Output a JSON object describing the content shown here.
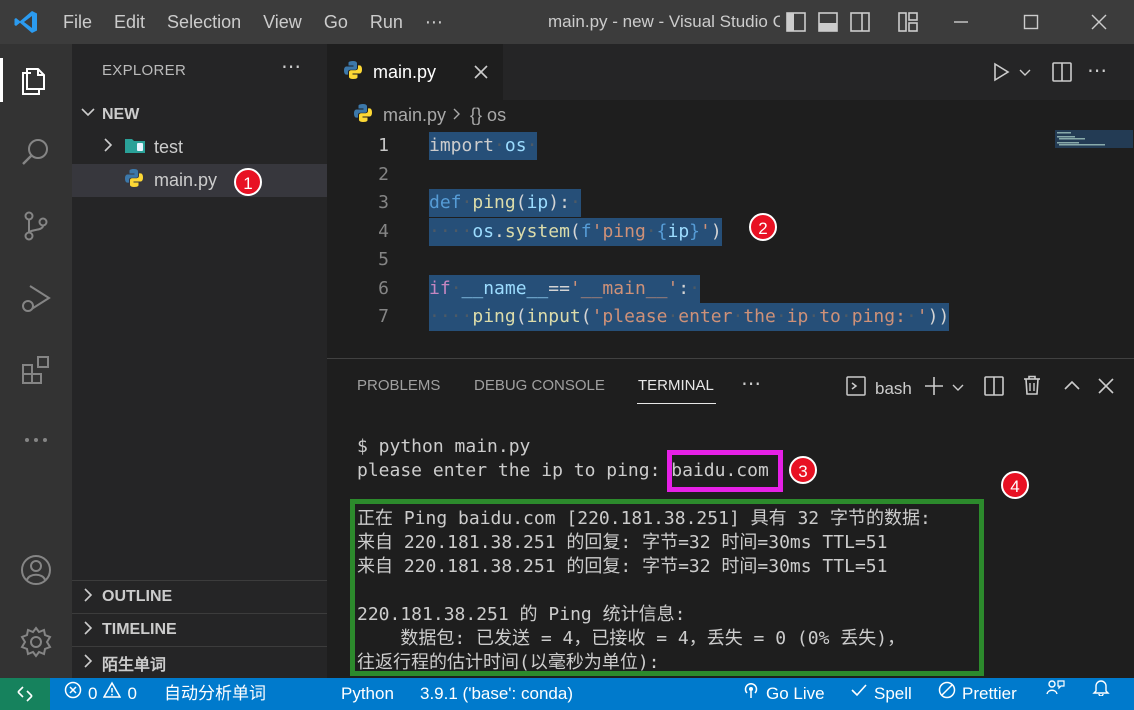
{
  "titlebar": {
    "menu": [
      "File",
      "Edit",
      "Selection",
      "View",
      "Go",
      "Run",
      "⋯"
    ],
    "window_title": "main.py - new - Visual Studio Code"
  },
  "sidebar": {
    "title": "EXPLORER",
    "more": "⋯",
    "folder": "NEW",
    "items": [
      {
        "label": "test",
        "type": "folder"
      },
      {
        "label": "main.py",
        "type": "python-file"
      }
    ],
    "sections": [
      "OUTLINE",
      "TIMELINE",
      "陌生单词"
    ]
  },
  "editor": {
    "tab_label": "main.py",
    "breadcrumb": {
      "file": "main.py",
      "symbol": "{} os"
    },
    "line_numbers": [
      "1",
      "2",
      "3",
      "4",
      "5",
      "6",
      "7"
    ]
  },
  "panel": {
    "tabs": [
      "PROBLEMS",
      "DEBUG CONSOLE",
      "TERMINAL",
      "⋯"
    ],
    "active_tab": "TERMINAL",
    "shell": "bash",
    "terminal": {
      "command": "$ python main.py",
      "prompt": "please enter the ip to ping: ",
      "input": "baidu.com",
      "output": [
        "正在 Ping baidu.com [220.181.38.251] 具有 32 字节的数据:",
        "来自 220.181.38.251 的回复: 字节=32 时间=30ms TTL=51",
        "来自 220.181.38.251 的回复: 字节=32 时间=30ms TTL=51",
        "",
        "220.181.38.251 的 Ping 统计信息:",
        "    数据包: 已发送 = 4，已接收 = 4，丢失 = 0 (0% 丢失)，",
        "往返行程的估计时间(以毫秒为单位):"
      ]
    }
  },
  "annotations": [
    "1",
    "2",
    "3",
    "4"
  ],
  "statusbar": {
    "errors": "0",
    "warnings": "0",
    "extension_text": "自动分析单词",
    "language": "Python",
    "interpreter": "3.9.1 ('base': conda)",
    "go_live": "Go Live",
    "spell": "Spell",
    "prettier": "Prettier"
  },
  "colors": {
    "accent": "#007acc",
    "remote": "#16825d",
    "badge": "#e81123",
    "highlight_input": "#e620e6",
    "highlight_output": "#2c8a2c"
  }
}
